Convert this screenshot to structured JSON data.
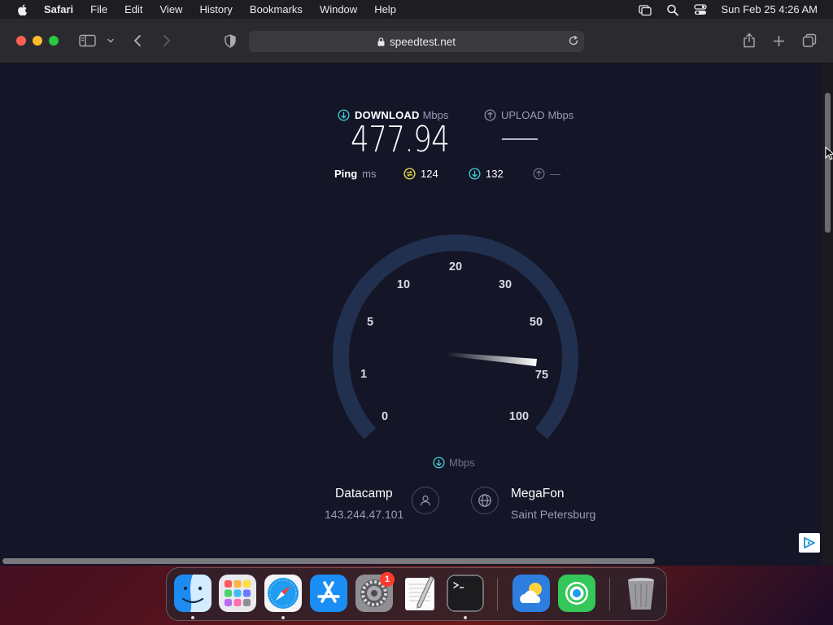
{
  "menubar": {
    "app_name": "Safari",
    "items": [
      "File",
      "Edit",
      "View",
      "History",
      "Bookmarks",
      "Window",
      "Help"
    ],
    "clock": "Sun Feb 25  4:26 AM"
  },
  "browser": {
    "url": "speedtest.net"
  },
  "speedtest": {
    "download": {
      "label": "DOWNLOAD",
      "unit": "Mbps",
      "value": "477.94"
    },
    "upload": {
      "label": "UPLOAD",
      "unit": "Mbps"
    },
    "ping": {
      "label": "Ping",
      "unit": "ms",
      "idle": "124",
      "download": "132",
      "upload": "—"
    },
    "gauge": {
      "ticks": [
        "0",
        "1",
        "5",
        "10",
        "20",
        "30",
        "50",
        "75",
        "100"
      ],
      "unit_label": "Mbps"
    },
    "server": {
      "host": "Datacamp",
      "ip": "143.244.47.101",
      "isp": "MegaFon",
      "location": "Saint Petersburg"
    }
  },
  "dock": {
    "apps": [
      "Finder",
      "Launchpad",
      "Safari",
      "App Store",
      "System Settings",
      "TextEdit",
      "Terminal",
      "Weather",
      "Find My",
      "Trash"
    ],
    "settings_badge": "1"
  },
  "colors": {
    "page_bg": "#141527",
    "accent_cyan": "#3fd0d4",
    "gauge_track": "#22304f",
    "ping_idle": "#f0e34d"
  }
}
